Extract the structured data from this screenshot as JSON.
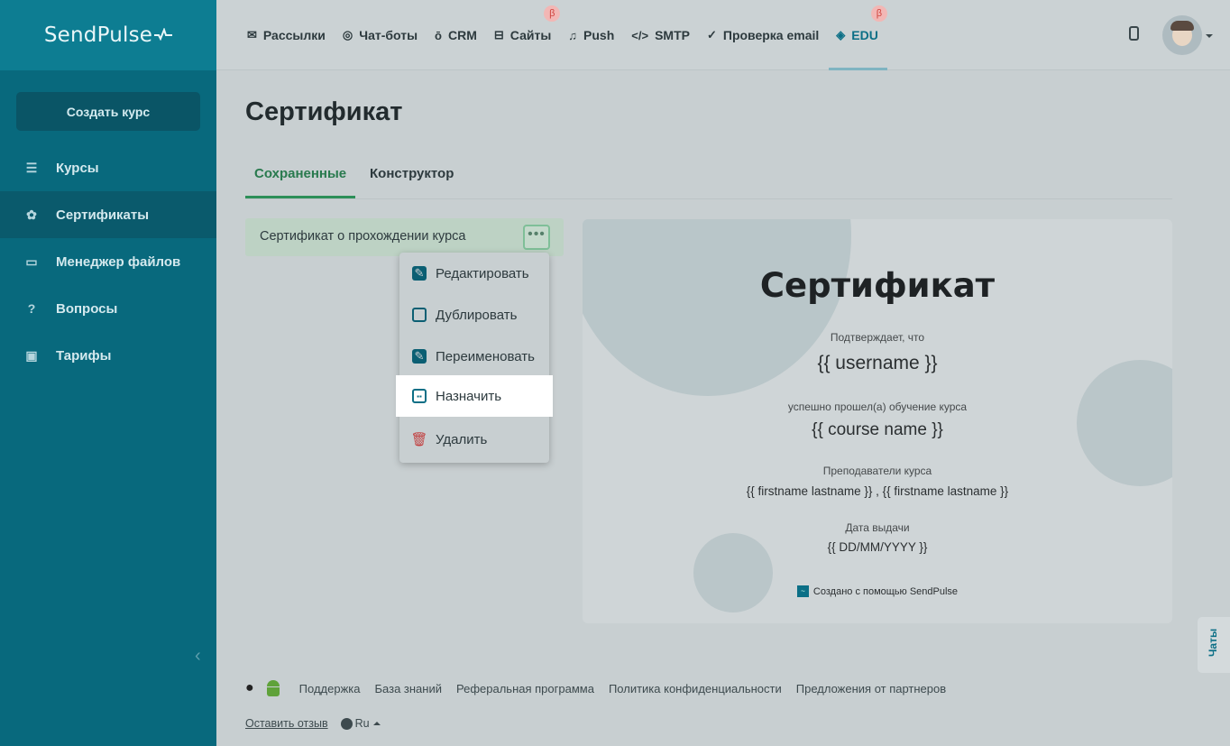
{
  "sidebar": {
    "logo_text": "SendPulse",
    "create_button": "Создать курс",
    "items": [
      {
        "label": "Курсы",
        "icon": "courses-icon"
      },
      {
        "label": "Сертификаты",
        "icon": "gear-icon"
      },
      {
        "label": "Менеджер файлов",
        "icon": "folder-icon"
      },
      {
        "label": "Вопросы",
        "icon": "question-icon"
      },
      {
        "label": "Тарифы",
        "icon": "wallet-icon"
      }
    ],
    "active_index": 1
  },
  "topnav": {
    "items": [
      {
        "label": "Рассылки",
        "icon": "mail-icon"
      },
      {
        "label": "Чат-боты",
        "icon": "chat-icon"
      },
      {
        "label": "CRM",
        "icon": "crm-icon"
      },
      {
        "label": "Сайты",
        "icon": "site-icon",
        "beta": "β"
      },
      {
        "label": "Push",
        "icon": "bell-icon"
      },
      {
        "label": "SMTP",
        "icon": "code-icon"
      },
      {
        "label": "Проверка email",
        "icon": "check-icon"
      },
      {
        "label": "EDU",
        "icon": "graduation-icon",
        "beta": "β"
      }
    ]
  },
  "main": {
    "title": "Сертификат",
    "tabs": [
      {
        "label": "Сохраненные"
      },
      {
        "label": "Конструктор"
      }
    ],
    "saved_item": {
      "label": "Сертификат о прохождении курса",
      "more": "•••"
    }
  },
  "menu": {
    "items": [
      {
        "label": "Редактировать",
        "icon": "edit-icon"
      },
      {
        "label": "Дублировать",
        "icon": "duplicate-icon"
      },
      {
        "label": "Переименовать",
        "icon": "rename-icon"
      },
      {
        "label": "Назначить",
        "icon": "assign-icon"
      },
      {
        "label": "Удалить",
        "icon": "trash-icon"
      }
    ]
  },
  "certificate": {
    "title": "Сертификат",
    "confirms": "Подтверждает, что",
    "username": "{{ username }}",
    "completed": "успешно прошел(а) обучение курса",
    "course": "{{ course name }}",
    "teachers_label": "Преподаватели курса",
    "teachers": "{{ firstname lastname }} , {{ firstname lastname }}",
    "date_label": "Дата выдачи",
    "date": "{{ DD/MM/YYYY }}",
    "footer": "Создано с помощью SendPulse"
  },
  "chats": {
    "label": "Чаты"
  },
  "footer": {
    "links": [
      "Поддержка",
      "База знаний",
      "Реферальная программа",
      "Политика конфиденциальности",
      "Предложения от партнеров"
    ],
    "feedback": "Оставить отзыв",
    "language": "Ru"
  },
  "colors": {
    "sidebar": "#08697d",
    "accent": "#0b6f86",
    "active_tab": "#2c8f58",
    "beta": "#d0453f"
  }
}
